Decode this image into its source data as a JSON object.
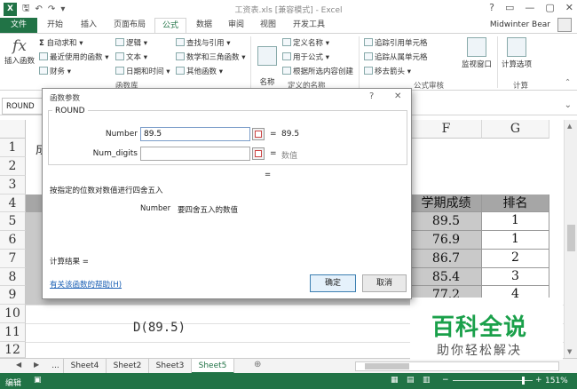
{
  "window": {
    "title": "工资表.xls [兼容模式] - Excel",
    "controls": [
      "?",
      "▭",
      "—",
      "▢",
      "✕"
    ]
  },
  "tabs": [
    {
      "label": "文件"
    },
    {
      "label": "开始"
    },
    {
      "label": "插入"
    },
    {
      "label": "页面布局"
    },
    {
      "label": "公式"
    },
    {
      "label": "数据"
    },
    {
      "label": "审阅"
    },
    {
      "label": "视图"
    },
    {
      "label": "开发工具"
    }
  ],
  "user": {
    "name": "Midwinter Bear"
  },
  "ribbon": {
    "insert_function": "插入函数",
    "autosum": "自动求和",
    "recent": "最近使用的函数",
    "finance": "财务",
    "logical": "逻辑",
    "text": "文本",
    "datetime": "日期和时间",
    "lookup": "查找与引用",
    "math": "数学和三角函数",
    "other": "其他函数",
    "group_library": "函数库",
    "name_manager": "名称\n管理器",
    "define_name": "定义名称",
    "use_in_formula": "用于公式",
    "create_from_sel": "根据所选内容创建",
    "group_names": "定义的名称",
    "trace_precedents": "追踪引用单元格",
    "trace_dependents": "追踪从属单元格",
    "remove_arrows": "移去箭头",
    "group_audit": "公式审核",
    "watch": "监视窗口",
    "calc_options": "计算选项",
    "group_calc": "计算"
  },
  "formula_bar": {
    "name_box": "ROUND"
  },
  "sheet": {
    "col_headers": [
      "F",
      "G"
    ],
    "row_headers": [
      "1",
      "2",
      "3",
      "4",
      "5",
      "6",
      "7",
      "8",
      "9",
      "10",
      "11",
      "12"
    ],
    "a1_partial": "成",
    "header_f": "学期成绩",
    "header_g": "排名",
    "scores": [
      "89.5",
      "76.9",
      "86.7",
      "85.4",
      "77.2"
    ],
    "ranks": [
      "1",
      "1",
      "2",
      "3",
      "4"
    ],
    "cell_d11": "D(89.5)"
  },
  "sheet_tabs": {
    "ellipsis": "...",
    "tabs": [
      "Sheet4",
      "Sheet2",
      "Sheet3",
      "Sheet5"
    ],
    "active": "Sheet5"
  },
  "status": {
    "mode": "编辑",
    "zoom": "151%"
  },
  "dialog": {
    "title": "函数参数",
    "function_name": "ROUND",
    "args": [
      {
        "label": "Number",
        "value": "89.5",
        "result": "89.5"
      },
      {
        "label": "Num_digits",
        "value": "",
        "result": "数值"
      }
    ],
    "eq": "=",
    "description": "按指定的位数对数值进行四舍五入",
    "arg_help_label": "Number",
    "arg_help_text": "要四舍五入的数值",
    "result_label": "计算结果 =",
    "help_link": "有关该函数的帮助(H)",
    "ok": "确定",
    "cancel": "取消"
  },
  "watermark": {
    "main": "百科全说",
    "sub": "助你轻松解决"
  },
  "colors": {
    "excel_green": "#217346",
    "link_blue": "#1a5fb4",
    "watermark_green": "#1aa04a"
  }
}
